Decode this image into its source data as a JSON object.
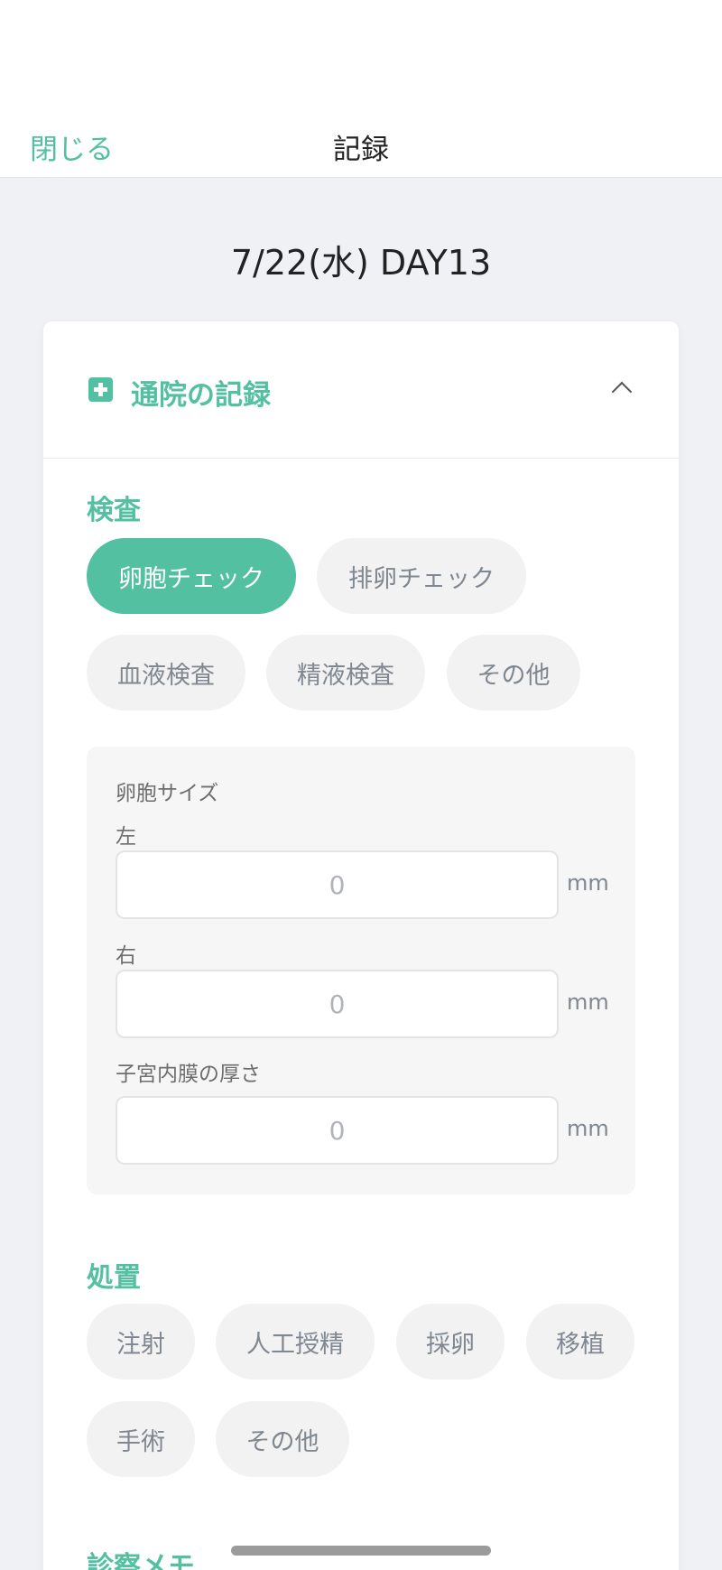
{
  "header": {
    "close_label": "閉じる",
    "title": "記録"
  },
  "date_title": "7/22(水) DAY13",
  "card": {
    "title": "通院の記録",
    "exam": {
      "title": "検査",
      "chips": [
        {
          "label": "卵胞チェック",
          "selected": true
        },
        {
          "label": "排卵チェック",
          "selected": false
        },
        {
          "label": "血液検査",
          "selected": false
        },
        {
          "label": "精液検査",
          "selected": false
        },
        {
          "label": "その他",
          "selected": false
        }
      ],
      "follicle_size_label": "卵胞サイズ",
      "left_label": "左",
      "right_label": "右",
      "endometrium_label": "子宮内膜の厚さ",
      "placeholder": "0",
      "unit": "mm"
    },
    "treatment": {
      "title": "処置",
      "chips": [
        {
          "label": "注射"
        },
        {
          "label": "人工授精"
        },
        {
          "label": "採卵"
        },
        {
          "label": "移植"
        },
        {
          "label": "手術"
        },
        {
          "label": "その他"
        }
      ]
    },
    "memo_title": "診察メモ"
  }
}
